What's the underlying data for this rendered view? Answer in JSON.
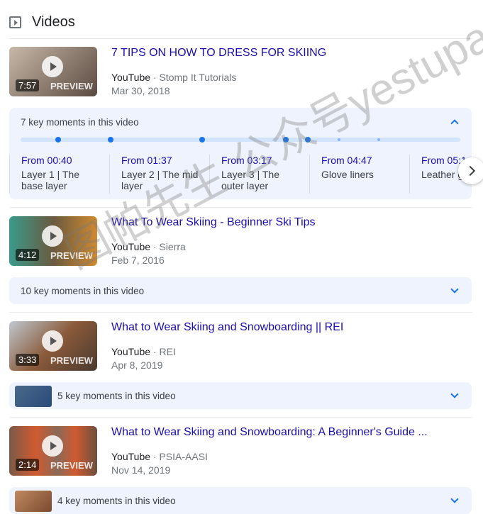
{
  "header": {
    "title": "Videos",
    "icon": "video-play-icon"
  },
  "videos": [
    {
      "title": "7 TIPS ON HOW TO DRESS FOR SKIING",
      "source": "YouTube",
      "channel": "Stomp It Tutorials",
      "date": "Mar 30, 2018",
      "duration": "7:57",
      "preview": "PREVIEW",
      "thumb_color": "#8a7a70",
      "key_moments": {
        "label": "7 key moments in this video",
        "expanded": true,
        "moments": [
          {
            "from": "From 00:40",
            "desc": "Layer 1 | The base layer"
          },
          {
            "from": "From 01:37",
            "desc": "Layer 2 | The mid layer"
          },
          {
            "from": "From 03:17",
            "desc": "Layer 3 | The outer layer"
          },
          {
            "from": "From 04:47",
            "desc": "Glove liners"
          },
          {
            "from": "From 05:1…",
            "desc": "Leather g…"
          }
        ]
      }
    },
    {
      "title": "What To Wear Skiing - Beginner Ski Tips",
      "source": "YouTube",
      "channel": "Sierra",
      "date": "Feb 7, 2016",
      "duration": "4:12",
      "preview": "PREVIEW",
      "thumb_color": "#b07a3a",
      "key_moments": {
        "label": "10 key moments in this video",
        "expanded": false
      }
    },
    {
      "title": "What to Wear Skiing and Snowboarding || REI",
      "source": "YouTube",
      "channel": "REI",
      "date": "Apr 8, 2019",
      "duration": "3:33",
      "preview": "PREVIEW",
      "thumb_color": "#7a5a48",
      "key_moments": {
        "label": "5 key moments in this video",
        "expanded": false,
        "mini_color": "#3a5a7a"
      }
    },
    {
      "title": "What to Wear Skiing and Snowboarding: A Beginner's Guide ...",
      "source": "YouTube",
      "channel": "PSIA-AASI",
      "date": "Nov 14, 2019",
      "duration": "2:14",
      "preview": "PREVIEW",
      "thumb_color": "#8a5a40",
      "key_moments": {
        "label": "4 key moments in this video",
        "expanded": false,
        "mini_color": "#9a6a50"
      }
    }
  ],
  "watermark": "图帕先生 公众号yestupa",
  "separator": " · "
}
